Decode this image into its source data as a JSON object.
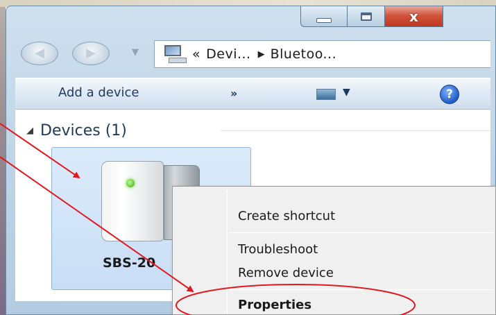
{
  "window": {
    "minimize_label": "",
    "maximize_label": "",
    "close_glyph": "x"
  },
  "address_bar": {
    "breadcrumb_overflow": "«",
    "crumbs": [
      "Devi...",
      "Bluetoo..."
    ],
    "separator": "▶",
    "icon": "computer-icon"
  },
  "toolbar": {
    "add_device_label": "Add a device",
    "more_label": "»",
    "help_label": "?",
    "view_dropdown_glyph": "▼"
  },
  "devices_group": {
    "toggle_glyph": "◢",
    "title": "Devices (1)",
    "items": [
      {
        "label": "SBS-20",
        "icon": "bluetooth-speaker-icon"
      }
    ]
  },
  "context_menu": {
    "items": [
      {
        "label": "Create shortcut"
      },
      {
        "label": "Troubleshoot"
      },
      {
        "label": "Remove device"
      },
      {
        "label": "Properties",
        "bold": true
      }
    ]
  },
  "colors": {
    "annotation": "#e0191f",
    "toolbar_text": "#1e395b",
    "selection": "#c8def5"
  }
}
